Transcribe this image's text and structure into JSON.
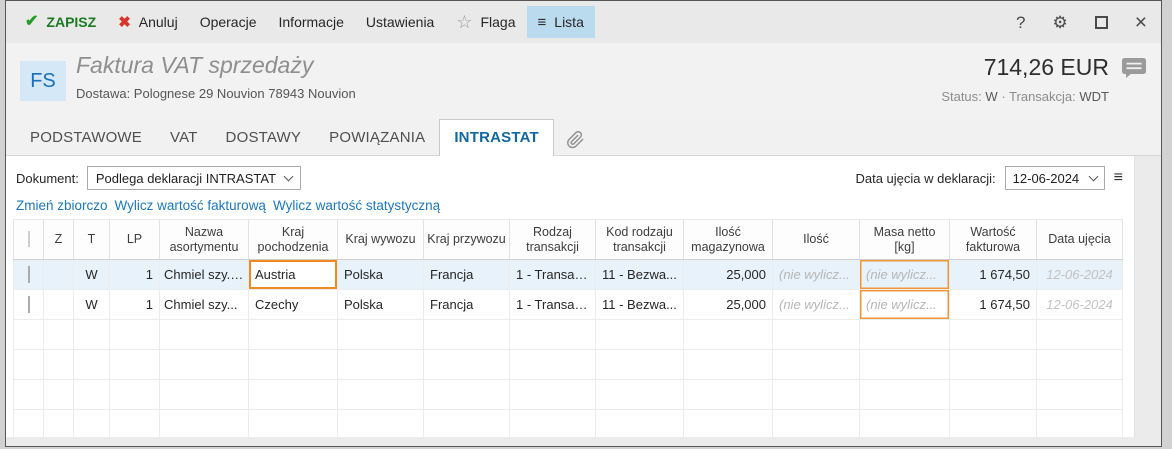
{
  "toolbar": {
    "save": "ZAPISZ",
    "cancel": "Anuluj",
    "operations": "Operacje",
    "information": "Informacje",
    "settings": "Ustawienia",
    "flag": "Flaga",
    "list": "Lista",
    "help": "?"
  },
  "icons": {
    "check": "✔",
    "cancel_x": "✖",
    "flag_star": "☆",
    "list_menu": "≡",
    "gear": "⚙",
    "close": "×",
    "date_menu": "≡"
  },
  "header": {
    "doc_type_badge": "FS",
    "title": "Faktura VAT sprzedaży",
    "delivery": "Dostawa: Polognese 29 Nouvion 78943 Nouvion",
    "amount": "714,26 EUR",
    "status_label": "Status:",
    "status_value": "W",
    "separator": "·",
    "transaction_label": "Transakcja:",
    "transaction_value": "WDT"
  },
  "tabs": [
    {
      "label": "PODSTAWOWE",
      "active": false
    },
    {
      "label": "VAT",
      "active": false
    },
    {
      "label": "DOSTAWY",
      "active": false
    },
    {
      "label": "POWIĄZANIA",
      "active": false
    },
    {
      "label": "INTRASTAT",
      "active": true
    }
  ],
  "filter": {
    "document_label": "Dokument:",
    "document_value": "Podlega deklaracji INTRASTAT",
    "date_label": "Data ujęcia w deklaracji:",
    "date_value": "12-06-2024"
  },
  "actions": [
    "Zmień zbiorczo",
    "Wylicz wartość fakturową",
    "Wylicz wartość statystyczną"
  ],
  "table": {
    "columns": [
      "Z",
      "T",
      "LP",
      "Nazwa asortymentu",
      "Kraj pochodzenia",
      "Kraj wywozu",
      "Kraj przywozu",
      "Rodzaj transakcji",
      "Kod rodzaju transakcji",
      "Ilość magazynowa",
      "Ilość",
      "Masa netto [kg]",
      "Wartość fakturowa",
      "Data ujęcia"
    ],
    "rows": [
      {
        "z": "",
        "t": "W",
        "lp": "1",
        "name": "Chmiel szy.",
        "origin": "Austria",
        "export_country": "Polska",
        "import_country": "Francja",
        "transaction_type": "1 - Transak...",
        "transaction_code": "11 - Bezwa...",
        "stock_qty": "25,000",
        "qty": "(nie wylicz...",
        "net_mass": "(nie wylicz...",
        "invoice_value": "1 674,50",
        "intake_date": "12-06-2024"
      },
      {
        "z": "",
        "t": "W",
        "lp": "1",
        "name": "Chmiel szy...",
        "origin": "Czechy",
        "export_country": "Polska",
        "import_country": "Francja",
        "transaction_type": "1 - Transak...",
        "transaction_code": "11 - Bezwa...",
        "stock_qty": "25,000",
        "qty": "(nie wylicz...",
        "net_mass": "(nie wylicz...",
        "invoice_value": "1 674,50",
        "intake_date": "12-06-2024"
      }
    ]
  },
  "colors": {
    "accent_blue": "#13679f",
    "save_green": "#1d7a24",
    "cancel_red": "#d6362a",
    "selected_row_bg": "#e7f2fa",
    "cell_highlight_orange": "#ee8a21",
    "list_button_bg": "#badaee",
    "fs_badge_bg": "#d4e8f8",
    "fs_badge_text": "#1a70b6",
    "link_blue": "#1c77bb"
  }
}
